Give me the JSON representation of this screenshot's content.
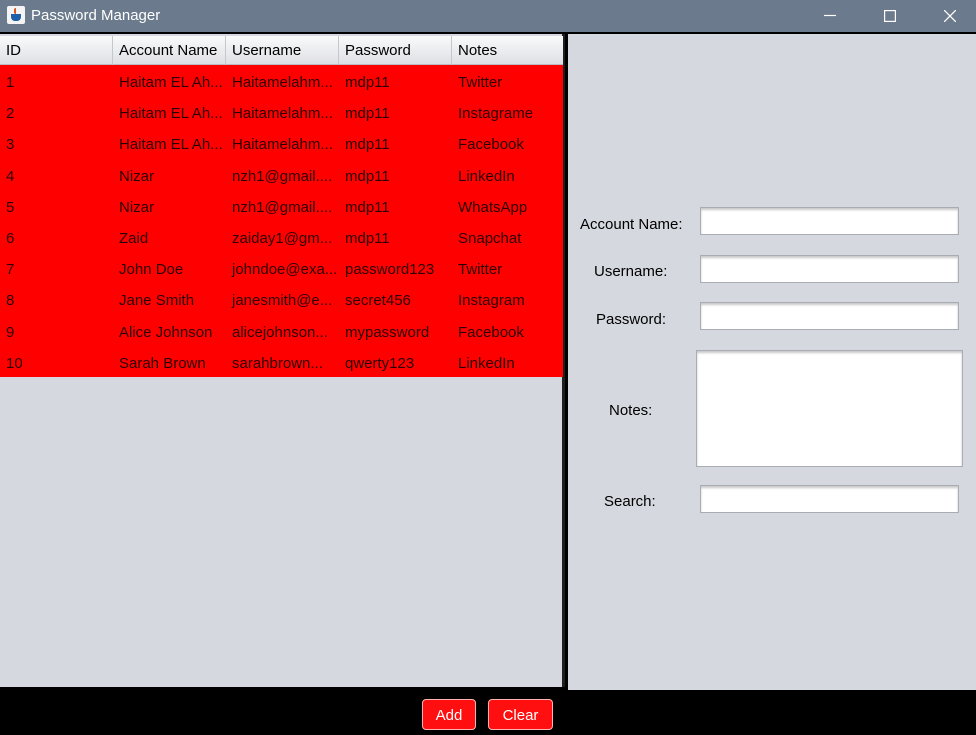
{
  "window": {
    "title": "Password Manager"
  },
  "table": {
    "columns": [
      "ID",
      "Account Name",
      "Username",
      "Password",
      "Notes"
    ],
    "rows": [
      [
        "1",
        "Haitam EL Ah...",
        "Haitamelahm...",
        "mdp11",
        "Twitter"
      ],
      [
        "2",
        "Haitam EL Ah...",
        "Haitamelahm...",
        "mdp11",
        "Instagrame"
      ],
      [
        "3",
        "Haitam EL Ah...",
        "Haitamelahm...",
        "mdp11",
        "Facebook"
      ],
      [
        "4",
        "Nizar",
        "nzh1@gmail....",
        "mdp11",
        "LinkedIn"
      ],
      [
        "5",
        "Nizar",
        "nzh1@gmail....",
        "mdp11",
        "WhatsApp"
      ],
      [
        "6",
        "Zaid",
        "zaiday1@gm...",
        "mdp11",
        "Snapchat"
      ],
      [
        "7",
        "John Doe",
        "johndoe@exa...",
        "password123",
        "Twitter"
      ],
      [
        "8",
        "Jane Smith",
        "janesmith@e...",
        "secret456",
        "Instagram"
      ],
      [
        "9",
        "Alice Johnson",
        "alicejohnson...",
        "mypassword",
        "Facebook"
      ],
      [
        "10",
        "Sarah Brown",
        "sarahbrown...",
        "qwerty123",
        "LinkedIn"
      ]
    ],
    "row_color": "#ff0000"
  },
  "form": {
    "account_label": "Account Name:",
    "account_value": "",
    "username_label": "Username:",
    "username_value": "",
    "password_label": "Password:",
    "password_value": "",
    "notes_label": "Notes:",
    "notes_value": "",
    "search_label": "Search:",
    "search_value": ""
  },
  "buttons": {
    "add": "Add",
    "clear": "Clear"
  },
  "icons": {
    "app": "java-cup-icon",
    "minimize": "minimize-icon",
    "maximize": "maximize-icon",
    "close": "close-icon"
  }
}
